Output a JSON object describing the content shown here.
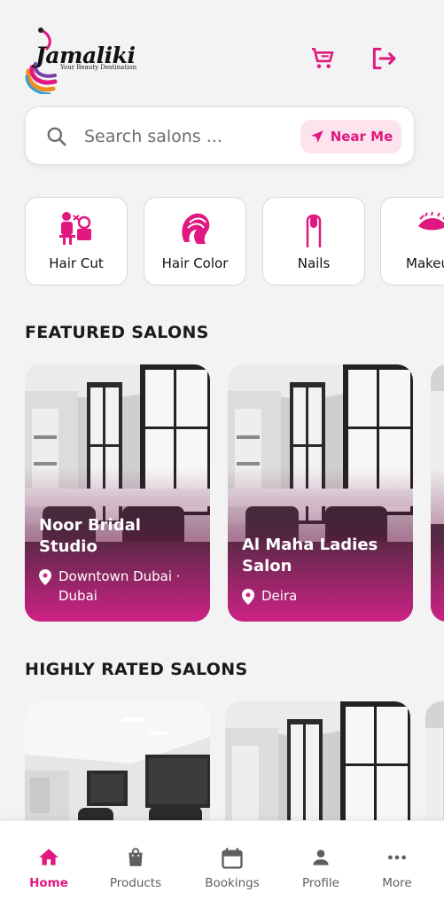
{
  "colors": {
    "accent": "#e0187f",
    "accent_soft": "#fde3ee",
    "background": "#f4f3f4"
  },
  "header": {
    "logo_text": "Jamaliki",
    "logo_tagline": "Your Beauty Destination",
    "cart_icon": "shopping-cart-icon",
    "logout_icon": "logout-icon"
  },
  "search": {
    "placeholder": "Search salons ...",
    "value": "",
    "near_me_label": "Near Me"
  },
  "categories": [
    {
      "label": "Hair Cut",
      "icon": "hair-cut-icon"
    },
    {
      "label": "Hair Color",
      "icon": "hair-color-icon"
    },
    {
      "label": "Nails",
      "icon": "nails-icon"
    },
    {
      "label": "Makeu",
      "icon": "makeup-eye-icon"
    }
  ],
  "featured": {
    "title": "FEATURED SALONS",
    "cards": [
      {
        "name": "Noor Bridal Studio",
        "location": "Downtown Dubai · Dubai"
      },
      {
        "name": "Al Maha Ladies Salon",
        "location": "Deira"
      }
    ]
  },
  "highly_rated": {
    "title": "HIGHLY RATED SALONS"
  },
  "bottom_nav": [
    {
      "label": "Home",
      "icon": "home-icon",
      "active": true
    },
    {
      "label": "Products",
      "icon": "shopping-bag-icon",
      "active": false
    },
    {
      "label": "Bookings",
      "icon": "calendar-icon",
      "active": false
    },
    {
      "label": "Profile",
      "icon": "person-icon",
      "active": false
    },
    {
      "label": "More",
      "icon": "more-dots-icon",
      "active": false
    }
  ]
}
